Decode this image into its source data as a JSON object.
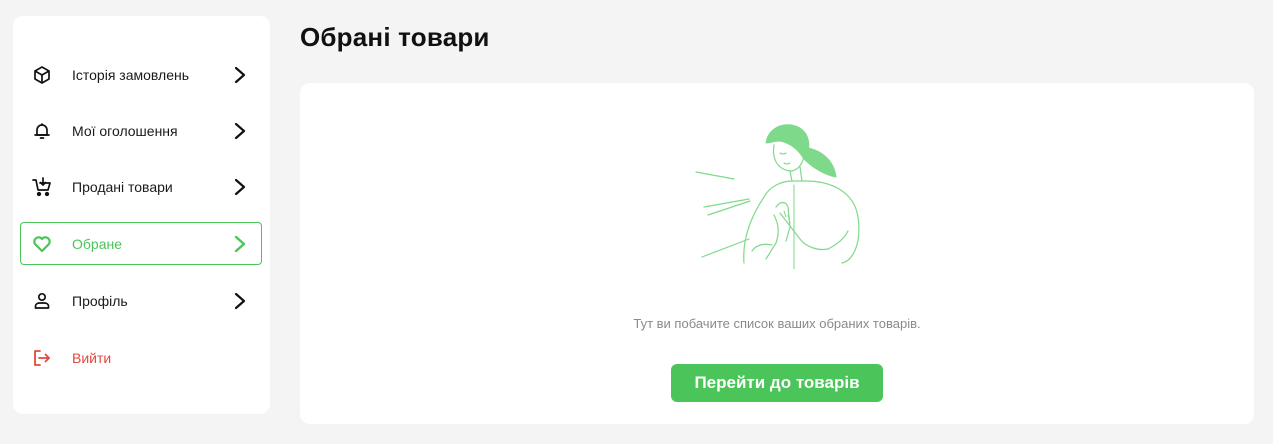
{
  "sidebar": {
    "items": [
      {
        "label": "Історія замовлень",
        "icon": "package-icon"
      },
      {
        "label": "Мої оголошення",
        "icon": "bell-icon"
      },
      {
        "label": "Продані товари",
        "icon": "cart-icon"
      },
      {
        "label": "Обране",
        "icon": "heart-icon",
        "active": true
      },
      {
        "label": "Профіль",
        "icon": "user-icon"
      },
      {
        "label": "Вийти",
        "icon": "logout-icon"
      }
    ]
  },
  "page": {
    "title": "Обрані товари"
  },
  "empty_state": {
    "message": "Тут ви побачите список ваших обраних товарів.",
    "button_label": "Перейти до товарів",
    "illustration": "woman-praying-illustration"
  },
  "colors": {
    "accent": "#4bc55a",
    "danger": "#e3473d",
    "background": "#f4f4f4",
    "card": "#ffffff",
    "muted_text": "#8a8a8a"
  }
}
